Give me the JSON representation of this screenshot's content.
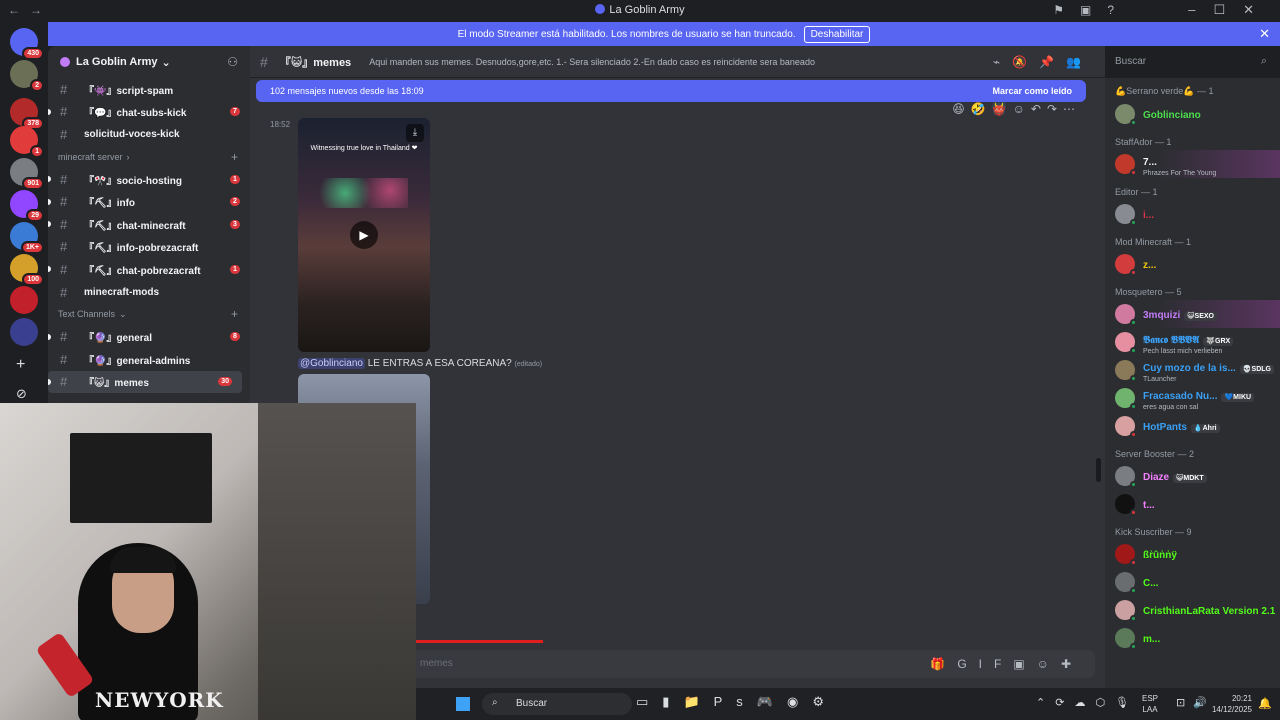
{
  "window": {
    "title": "La Goblin Army",
    "nav_back": "←",
    "nav_forward": "→",
    "title_icons": [
      "⚑",
      "▣",
      "?"
    ],
    "controls": [
      "–",
      "☐",
      "✕"
    ]
  },
  "banner": {
    "text": "El modo Streamer está habilitado. Los nombres de usuario se han truncado.",
    "button": "Deshabilitar",
    "close": "✕"
  },
  "servers": [
    {
      "badge": "430",
      "color": "#5865f2"
    },
    {
      "badge": "2",
      "color": "#6b6f55"
    },
    {
      "badge": "378",
      "color": "#b22a2a"
    },
    {
      "badge": "1",
      "color": "#e23b3b"
    },
    {
      "badge": "901",
      "color": "#7a7d82"
    },
    {
      "badge": "29",
      "color": "#9146ff"
    },
    {
      "badge": "1K+",
      "color": "#3a7bd5"
    },
    {
      "badge": "100",
      "color": "#d4a02a"
    },
    {
      "badge": "",
      "color": "#c2202a"
    },
    {
      "badge": "",
      "color": "#3b3f8f"
    }
  ],
  "rail": {
    "add": "+",
    "discover": "⊘"
  },
  "sidebar": {
    "guild_name": "La Goblin Army",
    "guild_chevron": "⌄",
    "invite_icon": "⚇",
    "channels_top": [
      {
        "name": "『👾』script-spam",
        "badge": ""
      },
      {
        "name": "『💬』chat-subs-kick",
        "badge": "7"
      },
      {
        "name": "solicitud-voces-kick",
        "badge": ""
      }
    ],
    "category_minecraft": "minecraft server",
    "channels_minecraft": [
      {
        "name": "『🎌』socio-hosting",
        "badge": "1"
      },
      {
        "name": "『⛏』info",
        "badge": "2"
      },
      {
        "name": "『⛏』chat-minecraft",
        "badge": "3"
      },
      {
        "name": "『⛏』info-pobrezacraft",
        "badge": ""
      },
      {
        "name": "『⛏』chat-pobrezacraft",
        "badge": "1"
      },
      {
        "name": "minecraft-mods",
        "badge": ""
      }
    ],
    "category_text": "Text Channels",
    "channels_text": [
      {
        "name": "『🔮』general",
        "badge": "8"
      },
      {
        "name": "『🔮』general-admins",
        "badge": ""
      },
      {
        "name": "『😺』memes",
        "badge": "30"
      }
    ],
    "plus": "+"
  },
  "header": {
    "hash": "#",
    "channel": "『😺』memes",
    "topic": "Aqui manden sus memes. Desnudos,gore,etc. 1.- Sera silenciado 2.-En dado caso es reincidente sera baneado",
    "icons": [
      "⌁",
      "🔕",
      "📌",
      "👥"
    ],
    "search_placeholder": "Buscar",
    "search_icon": "⌕"
  },
  "chat": {
    "new_messages": "102 mensajes nuevos desde las 18:09",
    "mark_read": "Marcar como leído",
    "toolbar": [
      "😆",
      "🤣",
      "👹",
      "☺",
      "↶",
      "↷",
      "⋯"
    ],
    "timestamp": "18:52",
    "video_caption": "Witnessing true love in Thailand ❤",
    "play": "▶",
    "download": "⤓",
    "mention": "@Goblinciano",
    "message": "LE ENTRAS A ESA COREANA?",
    "edited": "(editado)",
    "progress": 0.15
  },
  "input": {
    "placeholder": "memes",
    "icons": [
      "🎁",
      "GIF",
      "▣",
      "☺",
      "✚"
    ]
  },
  "members": {
    "groups": [
      {
        "title": "💪Serrano verde💪 — 1",
        "items": [
          {
            "name": "Goblinciano",
            "color": "#4dde4d",
            "sub": "",
            "tag": "",
            "av": "#7a8a6a",
            "status": "#23a55a"
          }
        ]
      },
      {
        "title": "StaffAdor — 1",
        "items": [
          {
            "name": "7...",
            "color": "#f2f3f5",
            "sub": "Phrazes For The Young",
            "tag": "",
            "av": "#c0392b",
            "status": "#da373c",
            "hl": true
          }
        ]
      },
      {
        "title": "Editor — 1",
        "items": [
          {
            "name": "i...",
            "color": "#e2324a",
            "sub": "",
            "tag": "",
            "av": "#888c92",
            "status": "#23a55a"
          }
        ]
      },
      {
        "title": "Mod Minecraft — 1",
        "items": [
          {
            "name": "z...",
            "color": "#f1c40f",
            "sub": "",
            "tag": "",
            "av": "#d23c3c",
            "status": "#da373c"
          }
        ]
      },
      {
        "title": "Mosquetero — 5",
        "items": [
          {
            "name": "3mquizi",
            "color": "#c27cf6",
            "sub": "",
            "tag": "😺SEXO",
            "av": "#d07aa0",
            "status": "#23a55a",
            "hl": true
          },
          {
            "name": "𝕭𝖆𝖓𝖈𝖔 𝕭𝕭𝖁𝕬",
            "color": "#3aa0f5",
            "sub": "Pech lässt mich verlieben",
            "tag": "🐺GRX",
            "av": "#e58fa0",
            "status": "#23a55a"
          },
          {
            "name": "Cuy mozo de la is...",
            "color": "#3aa0f5",
            "sub": "TLauncher",
            "tag": "💀SDLG",
            "av": "#8a7a5a",
            "status": "#23a55a"
          },
          {
            "name": "Fracasado Nu...",
            "color": "#3aa0f5",
            "sub": "eres agua con sal",
            "tag": "💙MIKU",
            "av": "#6fb36f",
            "status": "#23a55a"
          },
          {
            "name": "HotPants",
            "color": "#3aa0f5",
            "sub": "",
            "tag": "💧Ahri",
            "av": "#d8a0a0",
            "status": "#da373c"
          }
        ]
      },
      {
        "title": "Server Booster — 2",
        "items": [
          {
            "name": "Diaze",
            "color": "#f47fff",
            "sub": "",
            "tag": "😺MDKT",
            "av": "#7a7d82",
            "status": "#23a55a"
          },
          {
            "name": "t...",
            "color": "#f47fff",
            "sub": "",
            "tag": "",
            "av": "#111111",
            "status": "#da373c"
          }
        ]
      },
      {
        "title": "Kick Suscriber — 9",
        "items": [
          {
            "name": "ßṙûṅṅÿ",
            "color": "#53fc18",
            "sub": "",
            "tag": "",
            "av": "#a01818",
            "status": "#da373c"
          },
          {
            "name": "C...",
            "color": "#53fc18",
            "sub": "",
            "tag": "",
            "av": "#6a6d70",
            "status": "#23a55a"
          },
          {
            "name": "CristhianLaRata Version 2.1",
            "color": "#53fc18",
            "sub": "",
            "tag": "",
            "av": "#caa0a0",
            "status": "#23a55a"
          },
          {
            "name": "m...",
            "color": "#53fc18",
            "sub": "",
            "tag": "",
            "av": "#5a7a5a",
            "status": "#23a55a"
          }
        ]
      }
    ]
  },
  "webcam": {
    "shirt_text": "NEWYORK"
  },
  "taskbar": {
    "search": "Buscar",
    "search_icon": "⌕",
    "apps": [
      "▭",
      "▮",
      "📁",
      "Ps",
      "🎮",
      "◉",
      "⚙"
    ],
    "tray": [
      "⌃",
      "⟳",
      "☁",
      "⬡",
      "🎙"
    ],
    "lang_top": "ESP",
    "lang_bottom": "LAA",
    "sys": [
      "⊡",
      "🔊"
    ],
    "time": "20:21",
    "date": "14/12/2025",
    "notif": "🔔"
  }
}
